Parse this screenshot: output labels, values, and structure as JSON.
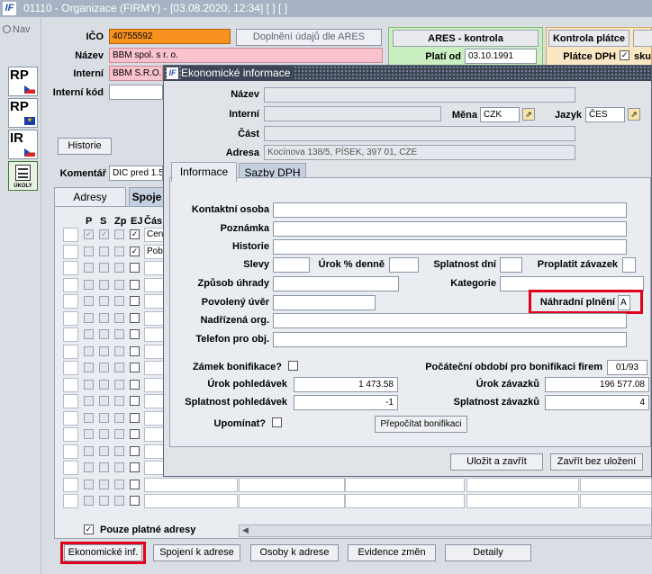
{
  "window": {
    "title": "01110 - Organizace (FIRMY) - [03.08.2020; 12:34]  [ ]  [ ]"
  },
  "nav": {
    "label": "Nav"
  },
  "sidebar": {
    "buttons": [
      {
        "label": "RP",
        "flag": "cz-flag-icon"
      },
      {
        "label": "RP",
        "flag": "eu-flag-icon"
      },
      {
        "label": "IR",
        "flag": "cz-flag-icon"
      },
      {
        "label": "ÚKOLY",
        "icon": "tasks-icon"
      }
    ]
  },
  "header": {
    "ico_label": "IČO",
    "ico_value": "40755592",
    "nazev_label": "Název",
    "nazev_value": "BBM spol. s r. o.",
    "interni_label": "Interní",
    "interni_value": "BBM S.R.O.",
    "interni_kod_label": "Interní kód",
    "ares_fill_button": "Doplnění údajů dle ARES",
    "ares_check_label": "ARES - kontrola",
    "plati_od_label": "Platí od",
    "plati_od_value": "03.10.1991",
    "kontrola_platce_label": "Kontrola plátce",
    "platce_dph_label": "Plátce DPH",
    "sku_label": "sku",
    "historie_button": "Historie",
    "komentar_label": "Komentář",
    "komentar_value": "DIC pred 1.5"
  },
  "main_tabs": [
    {
      "label": "Adresy"
    },
    {
      "label": "Spoje"
    }
  ],
  "address_table": {
    "headers": [
      "P",
      "S",
      "Zp",
      "EJ",
      "Čás"
    ],
    "rows": [
      {
        "p": true,
        "s": true,
        "zp": false,
        "ej": true,
        "text": "Cen"
      },
      {
        "p": false,
        "s": false,
        "zp": false,
        "ej": true,
        "text": "Pob"
      }
    ]
  },
  "only_valid_label": "Pouze platné adresy",
  "bottom_buttons": {
    "ekonomicke": "Ekonomické inf.",
    "spojeni": "Spojení k adrese",
    "osoby": "Osoby k adrese",
    "evidence": "Evidence změn",
    "detaily": "Detaily"
  },
  "dialog": {
    "title": "Ekonomické informace",
    "nazev_label": "Název",
    "interni_label": "Interní",
    "mena_label": "Měna",
    "mena_value": "CZK",
    "jazyk_label": "Jazyk",
    "jazyk_value": "ČES",
    "cast_label": "Část",
    "adresa_label": "Adresa",
    "adresa_value": "Kocínova 138/5, PÍSEK, 397 01, CZE",
    "tabs": [
      {
        "label": "Informace"
      },
      {
        "label": "Sazby DPH"
      }
    ],
    "form": {
      "kontaktni_osoba": "Kontaktní osoba",
      "poznamka": "Poznámka",
      "historie": "Historie",
      "slevy": "Slevy",
      "urok_denne": "Úrok % denně",
      "splatnost_dni": "Splatnost dní",
      "proplatit_zavazek": "Proplatit závazek",
      "zpusob_uhrady": "Způsob úhrady",
      "kategorie": "Kategorie",
      "povoleny_uver": "Povolený úvěr",
      "nahradni_plneni": "Náhradní plnění",
      "nahradni_plneni_value": "A",
      "nadrizena_org": "Nadřízená org.",
      "telefon": "Telefon pro obj.",
      "zamek_bonifikace": "Zámek bonifikace?",
      "pocatecni_obdobi": "Počáteční období pro bonifikaci firem",
      "pocatecni_obdobi_value": "01/93",
      "urok_pohledavek": "Úrok pohledávek",
      "urok_pohledavek_value": "1 473.58",
      "urok_zavazku": "Úrok závazků",
      "urok_zavazku_value": "196 577.08",
      "splatnost_pohledavek": "Splatnost pohledávek",
      "splatnost_pohledavek_value": "-1",
      "splatnost_zavazku": "Splatnost závazků",
      "splatnost_zavazku_value": "4",
      "upominat": "Upomínat?",
      "prepocitat_button": "Přepočítat bonifikaci"
    },
    "ulozit_button": "Uložit a zavřít",
    "zavrit_button": "Zavřít bez uložení"
  },
  "colors": {
    "highlight": "#e0001b",
    "ico_field": "#f7921e",
    "name_field": "#f9c2cc",
    "ares_panel": "#c9efc0"
  }
}
